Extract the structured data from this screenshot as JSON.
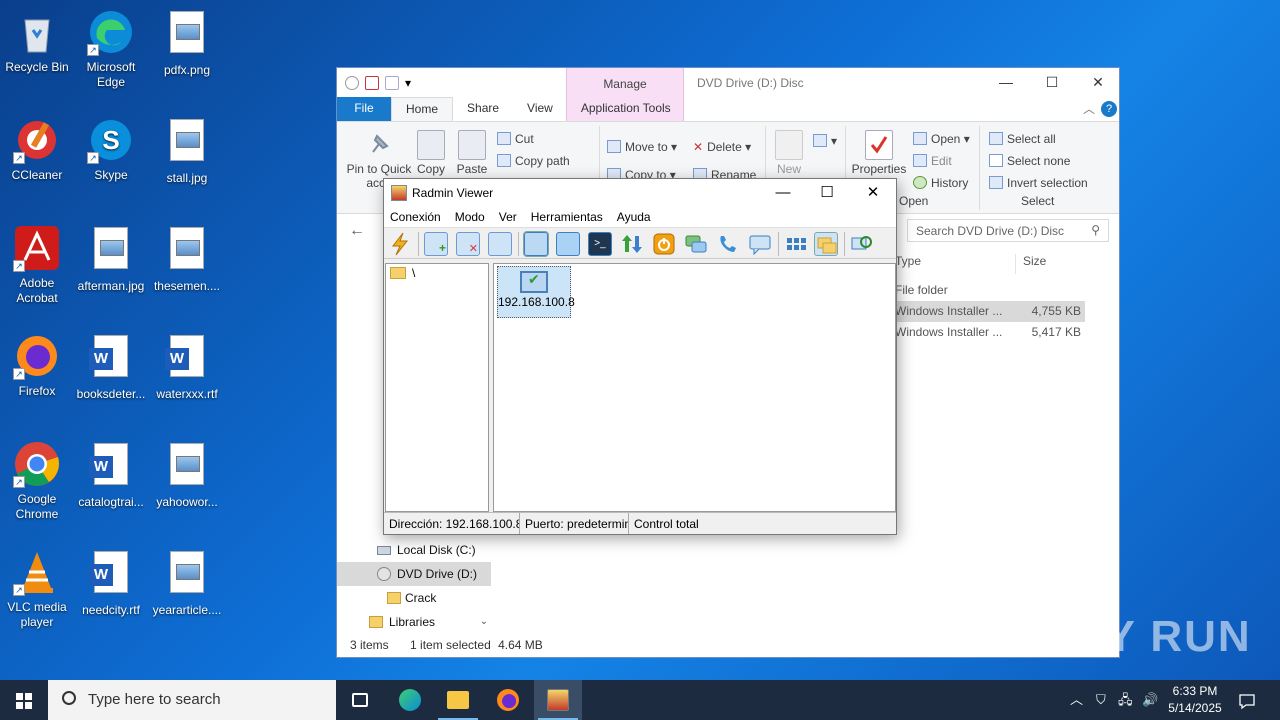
{
  "desktop": {
    "icons": [
      {
        "label": "Recycle Bin"
      },
      {
        "label": "Microsoft Edge"
      },
      {
        "label": "pdfx.png"
      },
      {
        "label": "CCleaner"
      },
      {
        "label": "Skype"
      },
      {
        "label": "stall.jpg"
      },
      {
        "label": "Adobe Acrobat"
      },
      {
        "label": "afterman.jpg"
      },
      {
        "label": "thesemen...."
      },
      {
        "label": "Firefox"
      },
      {
        "label": "booksdeter..."
      },
      {
        "label": "waterxxx.rtf"
      },
      {
        "label": "Google Chrome"
      },
      {
        "label": "catalogtrai..."
      },
      {
        "label": "yahoowor..."
      },
      {
        "label": "VLC media player"
      },
      {
        "label": "needcity.rtf"
      },
      {
        "label": "yeararticle...."
      }
    ]
  },
  "explorer": {
    "manage_tab": "Manage",
    "window_title": "DVD Drive (D:) Disc",
    "tabs": {
      "file": "File",
      "home": "Home",
      "share": "Share",
      "view": "View",
      "app_tools": "Application Tools"
    },
    "ribbon": {
      "pin": "Pin to Quick",
      "pin2": "acce",
      "copy": "Copy",
      "paste": "Paste",
      "cut": "Cut",
      "copy_path": "Copy path",
      "move_to": "Move to",
      "copy_to": "Copy to",
      "delete": "Delete",
      "rename": "Rename",
      "new": "New",
      "properties": "Properties",
      "open": "Open",
      "edit": "Edit",
      "history": "History",
      "open_group": "Open",
      "select_all": "Select all",
      "select_none": "Select none",
      "invert_selection": "Invert selection",
      "select_group": "Select"
    },
    "search_placeholder": "Search DVD Drive (D:) Disc",
    "columns": {
      "type": "Type",
      "size": "Size"
    },
    "rows": [
      {
        "type": "File folder",
        "size": ""
      },
      {
        "type": "Windows Installer ...",
        "size": "4,755 KB"
      },
      {
        "type": "Windows Installer ...",
        "size": "5,417 KB"
      }
    ],
    "nav": [
      {
        "label": "Local Disk (C:)"
      },
      {
        "label": "DVD Drive (D:)"
      },
      {
        "label": "Crack"
      },
      {
        "label": "Libraries"
      }
    ],
    "status": {
      "items": "3 items",
      "selected": "1 item selected",
      "size": "4.64 MB"
    }
  },
  "radmin": {
    "title": "Radmin Viewer",
    "menu": [
      "Conexión",
      "Modo",
      "Ver",
      "Herramientas",
      "Ayuda"
    ],
    "tree_root": "\\",
    "connection_ip": "192.168.100.8",
    "status": {
      "address": "Dirección: 192.168.100.8",
      "port": "Puerto: predetermin",
      "mode": "Control total"
    }
  },
  "taskbar": {
    "search_placeholder": "Type here to search",
    "time": "6:33 PM",
    "date": "5/14/2025"
  },
  "watermark": "ANY RUN"
}
